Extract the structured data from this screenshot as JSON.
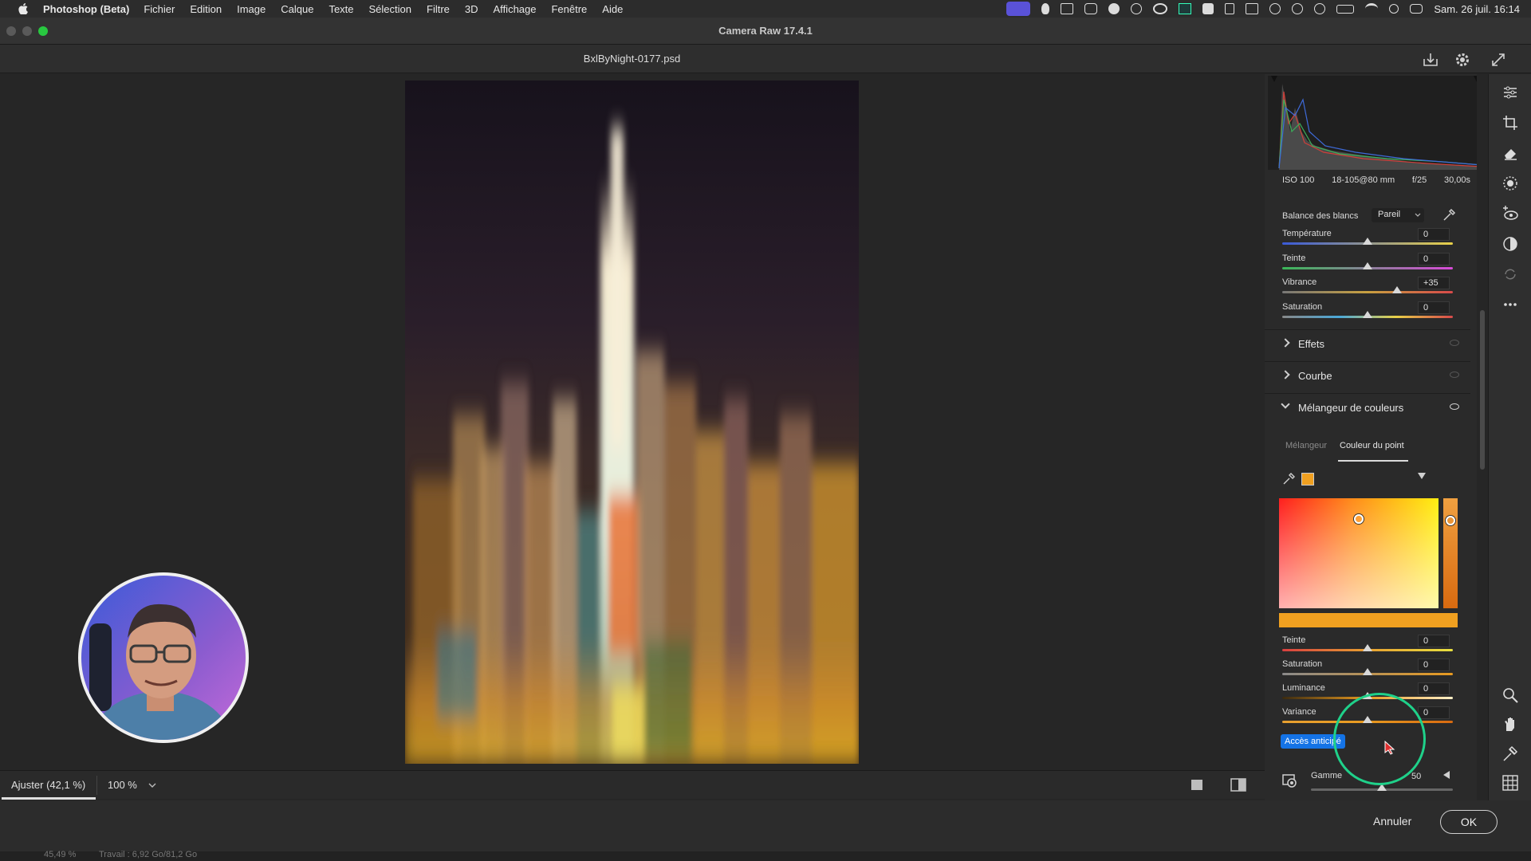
{
  "menubar": {
    "app_name": "Photoshop (Beta)",
    "items": [
      "Fichier",
      "Edition",
      "Image",
      "Calque",
      "Texte",
      "Sélection",
      "Filtre",
      "3D",
      "Affichage",
      "Fenêtre",
      "Aide"
    ],
    "clock": "Sam. 26 juil.  16:14"
  },
  "window": {
    "title": "Camera Raw 17.4.1",
    "file_name": "BxlByNight-0177.psd"
  },
  "bottom_bar": {
    "fit_label": "Ajuster (42,1 %)",
    "zoom_label": "100 %"
  },
  "footer": {
    "cancel_label": "Annuler",
    "ok_label": "OK",
    "status_zoom": "45,49 %",
    "status_work": "Travail : 6,92 Go/81,2 Go"
  },
  "exif": {
    "iso": "ISO 100",
    "lens": "18-105@80 mm",
    "aperture": "f/25",
    "shutter": "30,00s"
  },
  "white_balance": {
    "label": "Balance des blancs",
    "value": "Pareil"
  },
  "basic_sliders": [
    {
      "label": "Température",
      "value": "0",
      "level": 0.5
    },
    {
      "label": "Teinte",
      "value": "0",
      "level": 0.5
    },
    {
      "label": "Vibrance",
      "value": "+35",
      "level": 0.675
    },
    {
      "label": "Saturation",
      "value": "0",
      "level": 0.5
    }
  ],
  "sections": {
    "effects": "Effets",
    "curve": "Courbe",
    "color_mixer": "Mélangeur de couleurs"
  },
  "mixer_tabs": {
    "mixer": "Mélangeur",
    "point_color": "Couleur du point"
  },
  "point_sliders": [
    {
      "label": "Teinte",
      "value": "0",
      "level": 0.5
    },
    {
      "label": "Saturation",
      "value": "0",
      "level": 0.5
    },
    {
      "label": "Luminance",
      "value": "0",
      "level": 0.5
    },
    {
      "label": "Variance",
      "value": "0",
      "level": 0.5
    }
  ],
  "tooltip": "Accès anticipé",
  "range": {
    "label": "Gamme",
    "value": "50",
    "level": 0.5
  },
  "colors": {
    "swatch": "#f0a020",
    "accent": "#1473e6",
    "ring": "#1fd18a"
  }
}
